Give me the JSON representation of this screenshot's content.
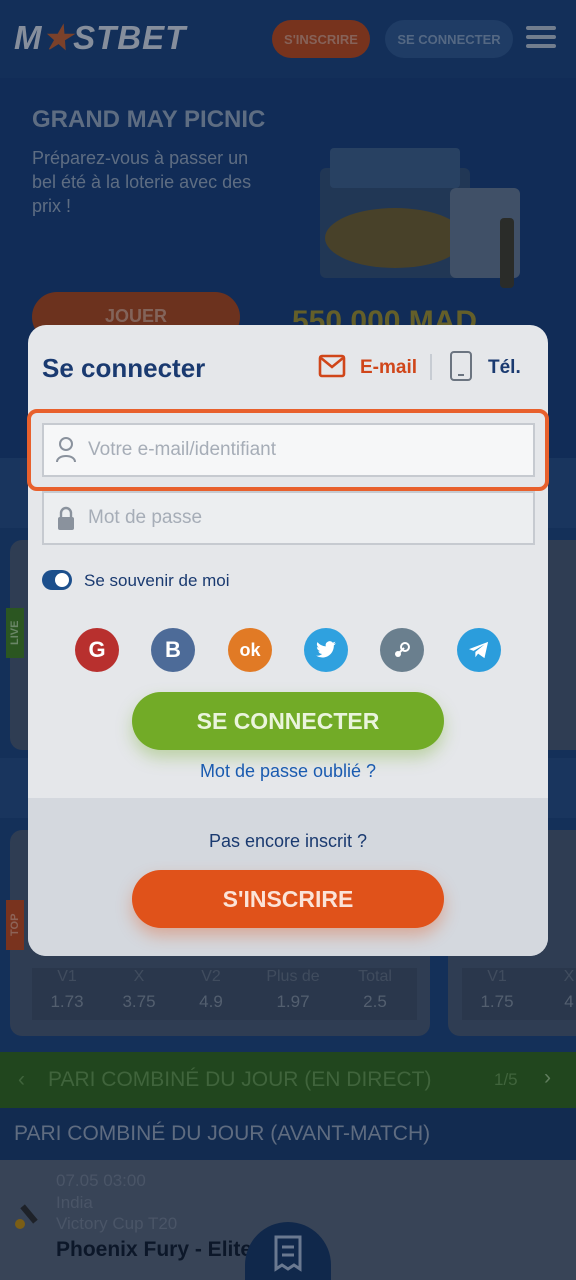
{
  "header": {
    "logo_text": "MOSTBET",
    "register_label": "S'INSCRIRE",
    "login_label": "SE CONNECTER",
    "menu_icon": "hamburger-icon"
  },
  "banner": {
    "title": "GRAND MAY PICNIC",
    "description": "Préparez-vous à passer un bel été à la loterie avec des prix !",
    "play_label": "JOUER",
    "amount": "550 000 MAD"
  },
  "background": {
    "live_tag": "LIVE",
    "top_tag": "TOP",
    "odds_left": [
      {
        "label": "V1",
        "value": "1.73"
      },
      {
        "label": "X",
        "value": "3.75"
      },
      {
        "label": "V2",
        "value": "4.9"
      },
      {
        "label": "Plus de",
        "value": "1.97"
      },
      {
        "label": "Total",
        "value": "2.5"
      }
    ],
    "odds_right": [
      {
        "label": "V1",
        "value": "1.75"
      },
      {
        "label": "X",
        "value": "4"
      }
    ],
    "combo_live": "PARI COMBINÉ DU JOUR (EN DIRECT)",
    "combo_live_page": "1/5",
    "combo_pre": "PARI COMBINÉ DU JOUR (AVANT-MATCH)",
    "match": {
      "datetime": "07.05 03:00",
      "country": "India",
      "league": "Victory Cup T20",
      "teams": "Phoenix Fury - Elite"
    }
  },
  "modal": {
    "title": "Se connecter",
    "tab_email": "E-mail",
    "tab_phone": "Tél.",
    "email_placeholder": "Votre e-mail/identifiant",
    "password_placeholder": "Mot de passe",
    "remember_label": "Se souvenir de moi",
    "social": [
      {
        "name": "google-icon",
        "glyph": "G",
        "color": "#c0392b"
      },
      {
        "name": "vk-icon",
        "glyph": "B",
        "color": "#4a6a9c"
      },
      {
        "name": "odnoklassniki-icon",
        "glyph": "ok",
        "color": "#e67e22"
      },
      {
        "name": "twitter-icon",
        "glyph": "t",
        "color": "#2ea3e3"
      },
      {
        "name": "steam-icon",
        "glyph": "S",
        "color": "#607d8b"
      },
      {
        "name": "telegram-icon",
        "glyph": "➤",
        "color": "#2a9ee0"
      }
    ],
    "login_button": "SE CONNECTER",
    "forgot_link": "Mot de passe oublié ?",
    "not_registered": "Pas encore inscrit ?",
    "register_button": "S'INSCRIRE"
  },
  "colors": {
    "accent_orange": "#e0521a",
    "accent_green": "#72ab27",
    "brand_blue": "#1a3a70",
    "highlight_outline": "#e8602c"
  }
}
